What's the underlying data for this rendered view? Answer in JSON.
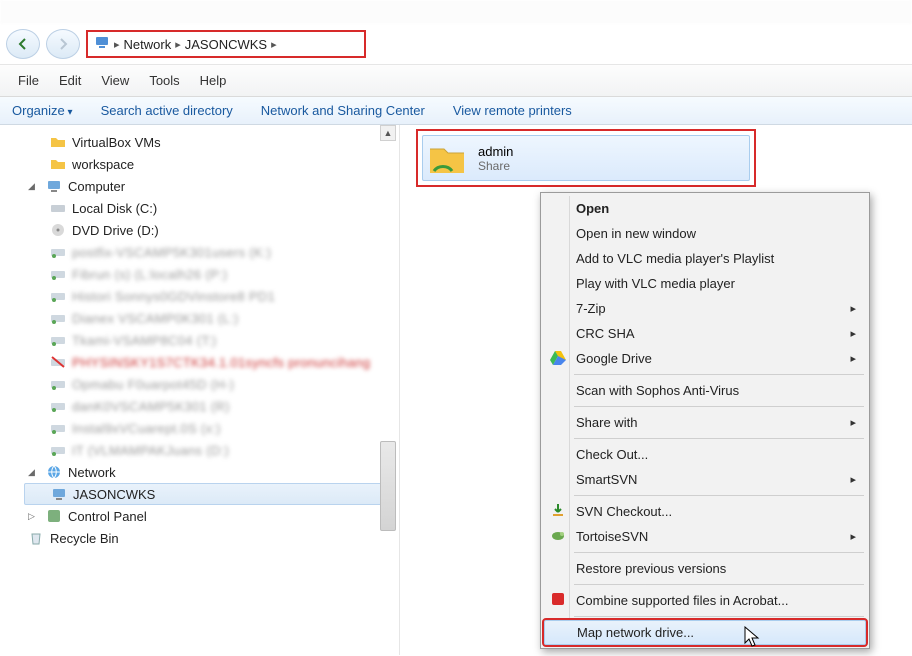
{
  "breadcrumb": {
    "root": "Network",
    "host": "JASONCWKS"
  },
  "menubar": [
    "File",
    "Edit",
    "View",
    "Tools",
    "Help"
  ],
  "toolbar": {
    "organize": "Organize",
    "search_dir": "Search active directory",
    "net_center": "Network and Sharing Center",
    "view_printers": "View remote printers"
  },
  "tree": {
    "vbox": "VirtualBox VMs",
    "workspace": "workspace",
    "computer": "Computer",
    "local_disk": "Local Disk (C:)",
    "dvd": "DVD Drive (D:)",
    "network": "Network",
    "host": "JASONCWKS",
    "control_panel": "Control Panel",
    "recycle_bin": "Recycle Bin",
    "blurred": [
      "postfix-VSCAMP5K301users (K:)",
      "Fibrun (s) (L:localh26 (P:)",
      "Histori Sonnys0GDVinstore8 PD1",
      "Dianex VSCAMP0K301 (L:)",
      "Tkami-VSAMP8C04 (T:)",
      "PHYSINSKY1S7CTK34.1.01syncfs pronuncihang",
      "Opmabu F0uarpot45D (H-)",
      "danK0VSCAMP5K301 (R)",
      "Instal9xVCuarept.0S (x:)",
      "IT (VLMAMPAKJuans (D:)"
    ]
  },
  "share": {
    "name": "admin",
    "type": "Share"
  },
  "context_menu": {
    "open": "Open",
    "open_new": "Open in new window",
    "vlc_playlist": "Add to VLC media player's Playlist",
    "vlc_play": "Play with VLC media player",
    "seven_zip": "7-Zip",
    "crc_sha": "CRC SHA",
    "gdrive": "Google Drive",
    "sophos": "Scan with Sophos Anti-Virus",
    "share_with": "Share with",
    "check_out": "Check Out...",
    "smartsvn": "SmartSVN",
    "svn_checkout": "SVN Checkout...",
    "tortoise": "TortoiseSVN",
    "restore": "Restore previous versions",
    "acrobat": "Combine supported files in Acrobat...",
    "map_drive": "Map network drive..."
  }
}
